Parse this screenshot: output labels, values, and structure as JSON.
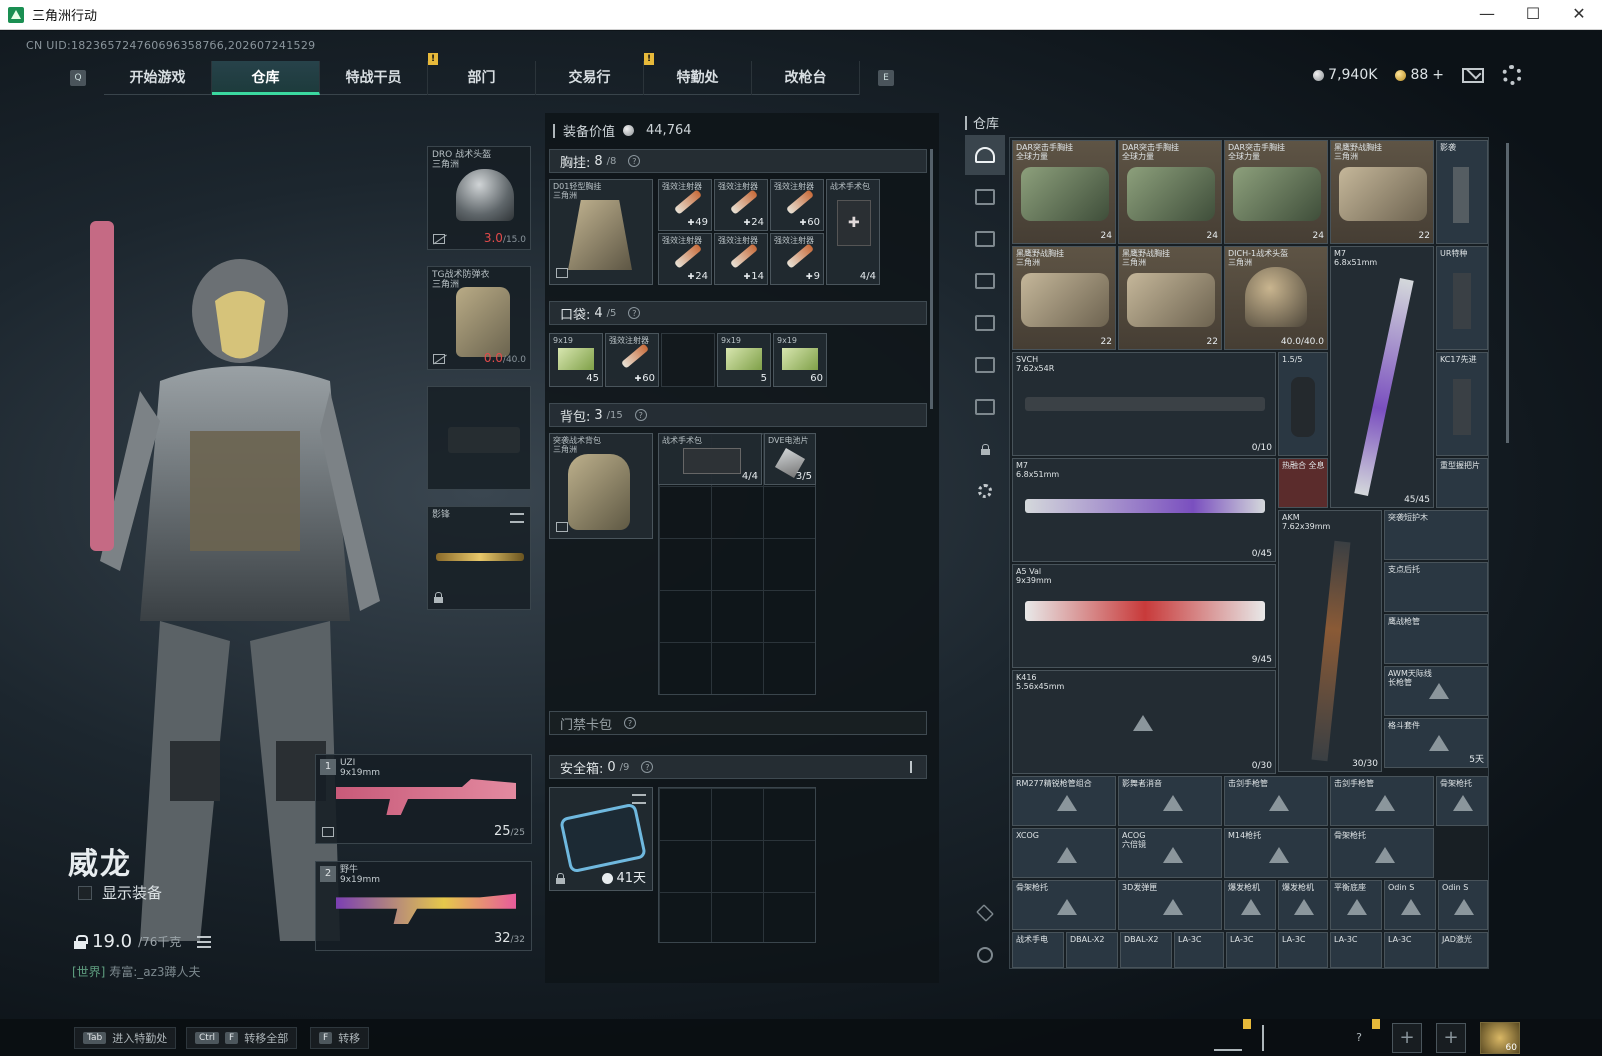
{
  "window": {
    "title": "三角洲行动",
    "controls": [
      "—",
      "☐",
      "✕"
    ]
  },
  "uid": "CN UID:1823657247606963587б6,202607241529",
  "nav": {
    "left_key": "Q",
    "right_key": "E",
    "tabs": [
      {
        "label": "开始游戏",
        "active": false,
        "notice": ""
      },
      {
        "label": "仓库",
        "active": true,
        "notice": ""
      },
      {
        "label": "特战干员",
        "active": false,
        "notice": ""
      },
      {
        "label": "部门",
        "active": false,
        "notice": "!"
      },
      {
        "label": "交易行",
        "active": false,
        "notice": ""
      },
      {
        "label": "特勤处",
        "active": false,
        "notice": "!"
      },
      {
        "label": "改枪台",
        "active": false,
        "notice": ""
      }
    ]
  },
  "currency": {
    "silver": "7,940K",
    "gold": "88",
    "plus": "+"
  },
  "operator": {
    "name": "威龙",
    "show_equipment_label": "显示装备",
    "weight": "19.0",
    "weight_max": "/76千克",
    "chat_channel": "[世界]",
    "chat_text": " 寿富:_az3蹲人夫"
  },
  "equip_slots": {
    "helmet": {
      "name": "DRO 战术头盔",
      "sub": "三角洲",
      "durability": "3.0",
      "durability_max": "/15.0"
    },
    "armor": {
      "name": "TG战术防弹衣",
      "sub": "三角洲",
      "durability": "0.0",
      "durability_max": "/40.0"
    },
    "melee": {
      "name": "影锋"
    },
    "primary1": {
      "num": "1",
      "name": "UZI",
      "sub": "9x19mm",
      "ammo": "25",
      "ammo_max": "/25"
    },
    "primary2": {
      "num": "2",
      "name": "野牛",
      "sub": "9x19mm",
      "ammo": "32",
      "ammo_max": "/32"
    }
  },
  "loadout": {
    "value_label": "装备价值",
    "value": "44,764",
    "chest": {
      "title": "胸挂:",
      "count": "8",
      "max": "/8",
      "rig_name": "D01轻型胸挂",
      "rig_sub": "三角洲",
      "items": [
        {
          "label": "强效注射器",
          "qty": "49"
        },
        {
          "label": "强效注射器",
          "qty": "24"
        },
        {
          "label": "强效注射器",
          "qty": "60"
        },
        {
          "label": "强效注射器",
          "qty": "24"
        },
        {
          "label": "强效注射器",
          "qty": "14"
        },
        {
          "label": "强效注射器",
          "qty": "9"
        }
      ],
      "medkit": {
        "label": "战术手术包",
        "qty": "4/4"
      }
    },
    "pocket": {
      "title": "口袋:",
      "count": "4",
      "max": "/5",
      "items": [
        {
          "label": "9x19",
          "qty": "45"
        },
        {
          "label": "强效注射器",
          "qty": "60"
        },
        {
          "label": "",
          "qty": ""
        },
        {
          "label": "9x19",
          "qty": "5"
        },
        {
          "label": "9x19",
          "qty": "60"
        }
      ]
    },
    "backpack": {
      "title": "背包:",
      "count": "3",
      "max": "/15",
      "bag_name": "突袭战术背包",
      "bag_sub": "三角洲",
      "items": [
        {
          "label": "战术手术包",
          "qty": "4/4"
        },
        {
          "label": "DVE电池片",
          "qty": "3/5"
        }
      ]
    },
    "keycard": {
      "title": "门禁卡包"
    },
    "safebox": {
      "title": "安全箱:",
      "count": "0",
      "max": "/9",
      "timer": "41天"
    }
  },
  "warehouse": {
    "title": "仓库",
    "cells": [
      {
        "label": "DAR突击手胸挂",
        "sub": "全球力量",
        "qty": "24"
      },
      {
        "label": "DAR突击手胸挂",
        "sub": "全球力量",
        "qty": "24"
      },
      {
        "label": "DAR突击手胸挂",
        "sub": "全球力量",
        "qty": "24"
      },
      {
        "label": "黑鹰野战胸挂",
        "sub": "三角洲",
        "qty": "22"
      },
      {
        "label": "影袭",
        "sub": "",
        "qty": ""
      },
      {
        "label": "黑鹰野战胸挂",
        "sub": "三角洲",
        "qty": "22"
      },
      {
        "label": "黑鹰野战胸挂",
        "sub": "三角洲",
        "qty": "22"
      },
      {
        "label": "DICH-1战术头盔",
        "sub": "三角洲",
        "qty": "40.0/40.0"
      },
      {
        "label": "M7",
        "sub": "6.8x51mm",
        "qty": "45/45"
      },
      {
        "label": "UR特种",
        "sub": "",
        "qty": ""
      },
      {
        "label": "SVCH",
        "sub": "7.62x54R",
        "qty": "0/10"
      },
      {
        "label": "1.5/5",
        "sub": "",
        "qty": ""
      },
      {
        "label": "KC17先进",
        "sub": "",
        "qty": ""
      },
      {
        "label": "M7",
        "sub": "6.8x51mm",
        "qty": "0/45"
      },
      {
        "label": "热融合 全息",
        "sub": "",
        "qty": ""
      },
      {
        "label": "重型握把片",
        "sub": "",
        "qty": ""
      },
      {
        "label": "AKM",
        "sub": "7.62x39mm",
        "qty": "30/30"
      },
      {
        "label": "突袭短护木",
        "sub": "",
        "qty": ""
      },
      {
        "label": "A5 Val",
        "sub": "9x39mm",
        "qty": "9/45"
      },
      {
        "label": "支点后托",
        "sub": "",
        "qty": ""
      },
      {
        "label": "鹰战枪管",
        "sub": "",
        "qty": ""
      },
      {
        "label": "K416",
        "sub": "5.56x45mm",
        "qty": "0/30"
      },
      {
        "label": "AWM天际线",
        "sub": "长枪管",
        "qty": ""
      },
      {
        "label": "格斗套件",
        "sub": "",
        "qty": "5天"
      },
      {
        "label": "RM277精锐枪管组合",
        "sub": "",
        "qty": ""
      },
      {
        "label": "影舞者消音",
        "sub": "",
        "qty": ""
      },
      {
        "label": "击剑手枪管",
        "sub": "",
        "qty": ""
      },
      {
        "label": "击剑手枪管",
        "sub": "",
        "qty": ""
      },
      {
        "label": "骨架枪托",
        "sub": "",
        "qty": ""
      },
      {
        "label": "XCOG",
        "sub": "",
        "qty": ""
      },
      {
        "label": "ACOG",
        "sub": "六倍镜",
        "qty": ""
      },
      {
        "label": "M14枪托",
        "sub": "",
        "qty": ""
      },
      {
        "label": "骨架枪托",
        "sub": "",
        "qty": ""
      },
      {
        "label": "骨架枪托",
        "sub": "",
        "qty": ""
      },
      {
        "label": "3D发弹匣",
        "sub": "",
        "qty": ""
      },
      {
        "label": "爆发枪机",
        "sub": "",
        "qty": ""
      },
      {
        "label": "爆发枪机",
        "sub": "",
        "qty": ""
      },
      {
        "label": "平衡底座",
        "sub": "",
        "qty": ""
      },
      {
        "label": "Odin S",
        "sub": "",
        "qty": ""
      },
      {
        "label": "Odin S",
        "sub": "",
        "qty": ""
      },
      {
        "label": "战术手电",
        "sub": "",
        "qty": ""
      },
      {
        "label": "DBAL-X2",
        "sub": "",
        "qty": ""
      },
      {
        "label": "DBAL-X2",
        "sub": "",
        "qty": ""
      },
      {
        "label": "LA-3C",
        "sub": "",
        "qty": ""
      },
      {
        "label": "LA-3C",
        "sub": "",
        "qty": ""
      },
      {
        "label": "LA-3C",
        "sub": "",
        "qty": ""
      },
      {
        "label": "LA-3C",
        "sub": "",
        "qty": ""
      },
      {
        "label": "LA-3C",
        "sub": "",
        "qty": ""
      },
      {
        "label": "JAD激光",
        "sub": "",
        "qty": ""
      }
    ]
  },
  "bottom": {
    "hints": [
      {
        "keys": [
          "Tab"
        ],
        "label": "进入特勤处"
      },
      {
        "keys": [
          "Ctrl",
          "F"
        ],
        "label": "转移全部"
      },
      {
        "keys": [
          "F"
        ],
        "label": "转移"
      }
    ],
    "friends_count": "?",
    "avatar_level": "60"
  },
  "colors": {
    "accent": "#3bd9a0",
    "notice": "#e7b93a",
    "durability_low": "#e14a4a"
  }
}
